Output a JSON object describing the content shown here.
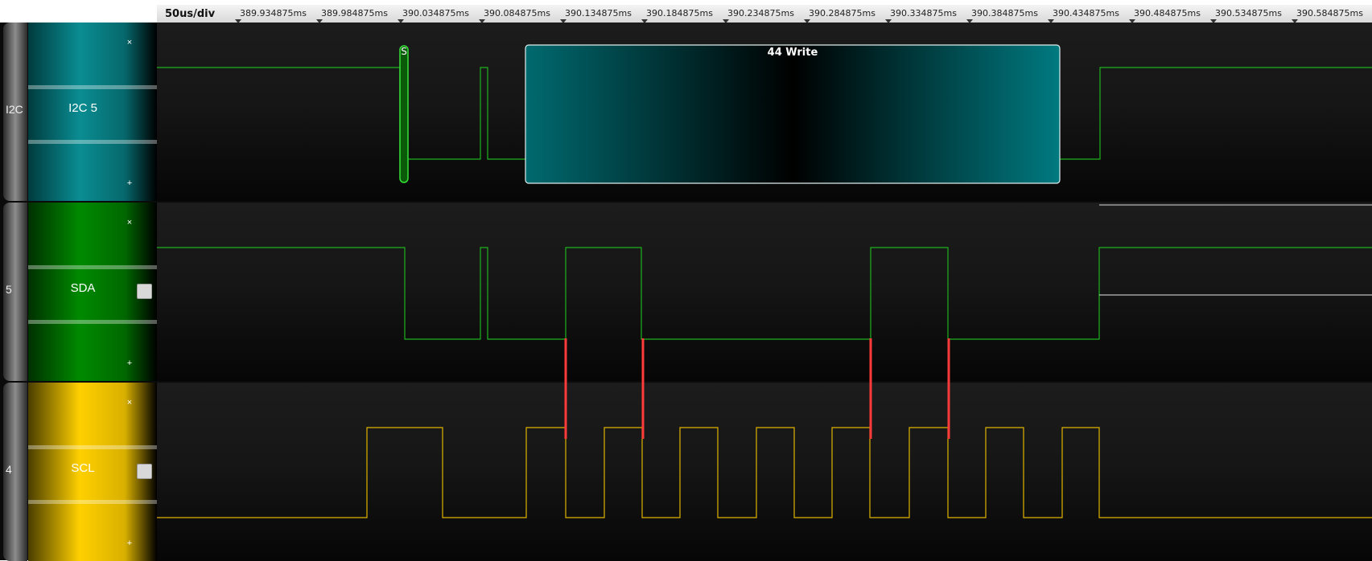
{
  "timeline": {
    "scale_label": "50us/div",
    "ticks": [
      "389.934875ms",
      "389.984875ms",
      "390.034875ms",
      "390.084875ms",
      "390.134875ms",
      "390.184875ms",
      "390.234875ms",
      "390.284875ms",
      "390.334875ms",
      "390.384875ms",
      "390.434875ms",
      "390.484875ms",
      "390.534875ms",
      "390.584875ms"
    ]
  },
  "lanes": [
    {
      "number": "I2C",
      "name": "I2C 5",
      "color": "#0e8f93",
      "has_checkbox": false
    },
    {
      "number": "5",
      "name": "SDA",
      "color": "#008a00",
      "has_checkbox": true
    },
    {
      "number": "4",
      "name": "SCL",
      "color": "#ffd200",
      "has_checkbox": true
    }
  ],
  "controls": {
    "collapse_glyph": "×",
    "expand_glyph": "+"
  },
  "decode": {
    "start_marker": "S",
    "packet_label": "44 Write"
  },
  "colors": {
    "sda_trace": "#1db31d",
    "scl_trace": "#e0b400",
    "packet_fill": "#006a6f",
    "sample_marker": "#ff3a3a"
  }
}
